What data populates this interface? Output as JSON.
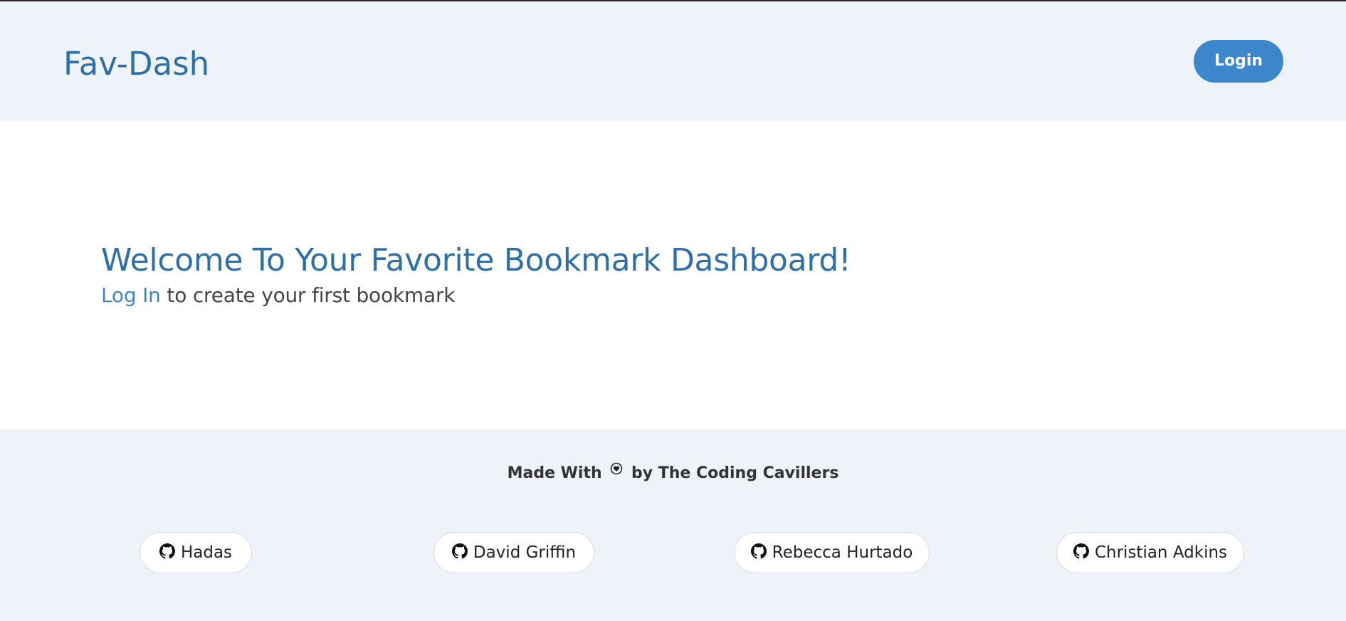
{
  "header": {
    "brand": "Fav-Dash",
    "login_label": "Login"
  },
  "hero": {
    "title": "Welcome To Your Favorite Bookmark Dashboard!",
    "login_link": "Log In",
    "subtitle_rest": " to create your first bookmark"
  },
  "footer": {
    "made_with_prefix": "Made With",
    "made_with_icon": "heart-icon",
    "made_with_suffix": "by The Coding Cavillers",
    "contributors": [
      {
        "name": "Hadas",
        "icon": "github-icon"
      },
      {
        "name": "David Griffin",
        "icon": "github-icon"
      },
      {
        "name": "Rebecca Hurtado",
        "icon": "github-icon"
      },
      {
        "name": "Christian Adkins",
        "icon": "github-icon"
      }
    ]
  },
  "colors": {
    "brand": "#2f6fa8",
    "accent": "#3c87cc",
    "header_bg": "#eef3fa",
    "footer_bg": "#eef3fa"
  }
}
